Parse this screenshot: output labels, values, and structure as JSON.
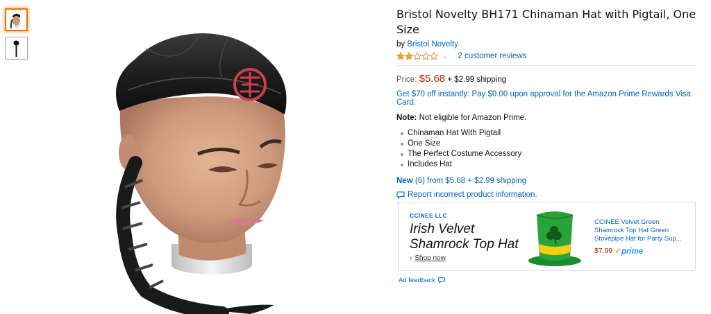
{
  "product": {
    "title": "Bristol Novelty BH171 Chinaman Hat with Pigtail, One Size",
    "by_label": "by",
    "brand": "Bristol Novelty",
    "rating_stars": 2,
    "reviews_link": "2 customer reviews",
    "price_label": "Price:",
    "price": "$5.68",
    "shipping": "+ $2.99 shipping",
    "promo": "Get $70 off instantly: Pay $0.00 upon approval for the Amazon Prime Rewards Visa Card.",
    "note_label": "Note:",
    "note_text": "Not eligible for Amazon Prime.",
    "bullets": [
      "Chinaman Hat With Pigtail",
      "One Size",
      "The Perfect Costume Accessory",
      "Includes Hat"
    ],
    "new_label": "New",
    "new_text": "(6) from $5.68 + $2.99 shipping",
    "report_link": "Report incorrect product information."
  },
  "ad": {
    "brand": "CCINEE LLC",
    "headline": "Irish Velvet Shamrock Top Hat",
    "shop_now": "Shop now",
    "product_title": "CCINEE Velvet Green Shamrock Top Hat Green Stovepipe Hat for Party Sup...",
    "price": "$7.99",
    "prime": "prime",
    "feedback": "Ad feedback"
  },
  "icons": {
    "star_full": "star-filled-icon",
    "star_empty": "star-empty-icon",
    "chevron": "chevron-down-icon",
    "report": "speech-bubble-icon"
  },
  "colors": {
    "link": "#0066c0",
    "price": "#b12704",
    "star": "#ffa41c",
    "active_thumb": "#e77600"
  }
}
